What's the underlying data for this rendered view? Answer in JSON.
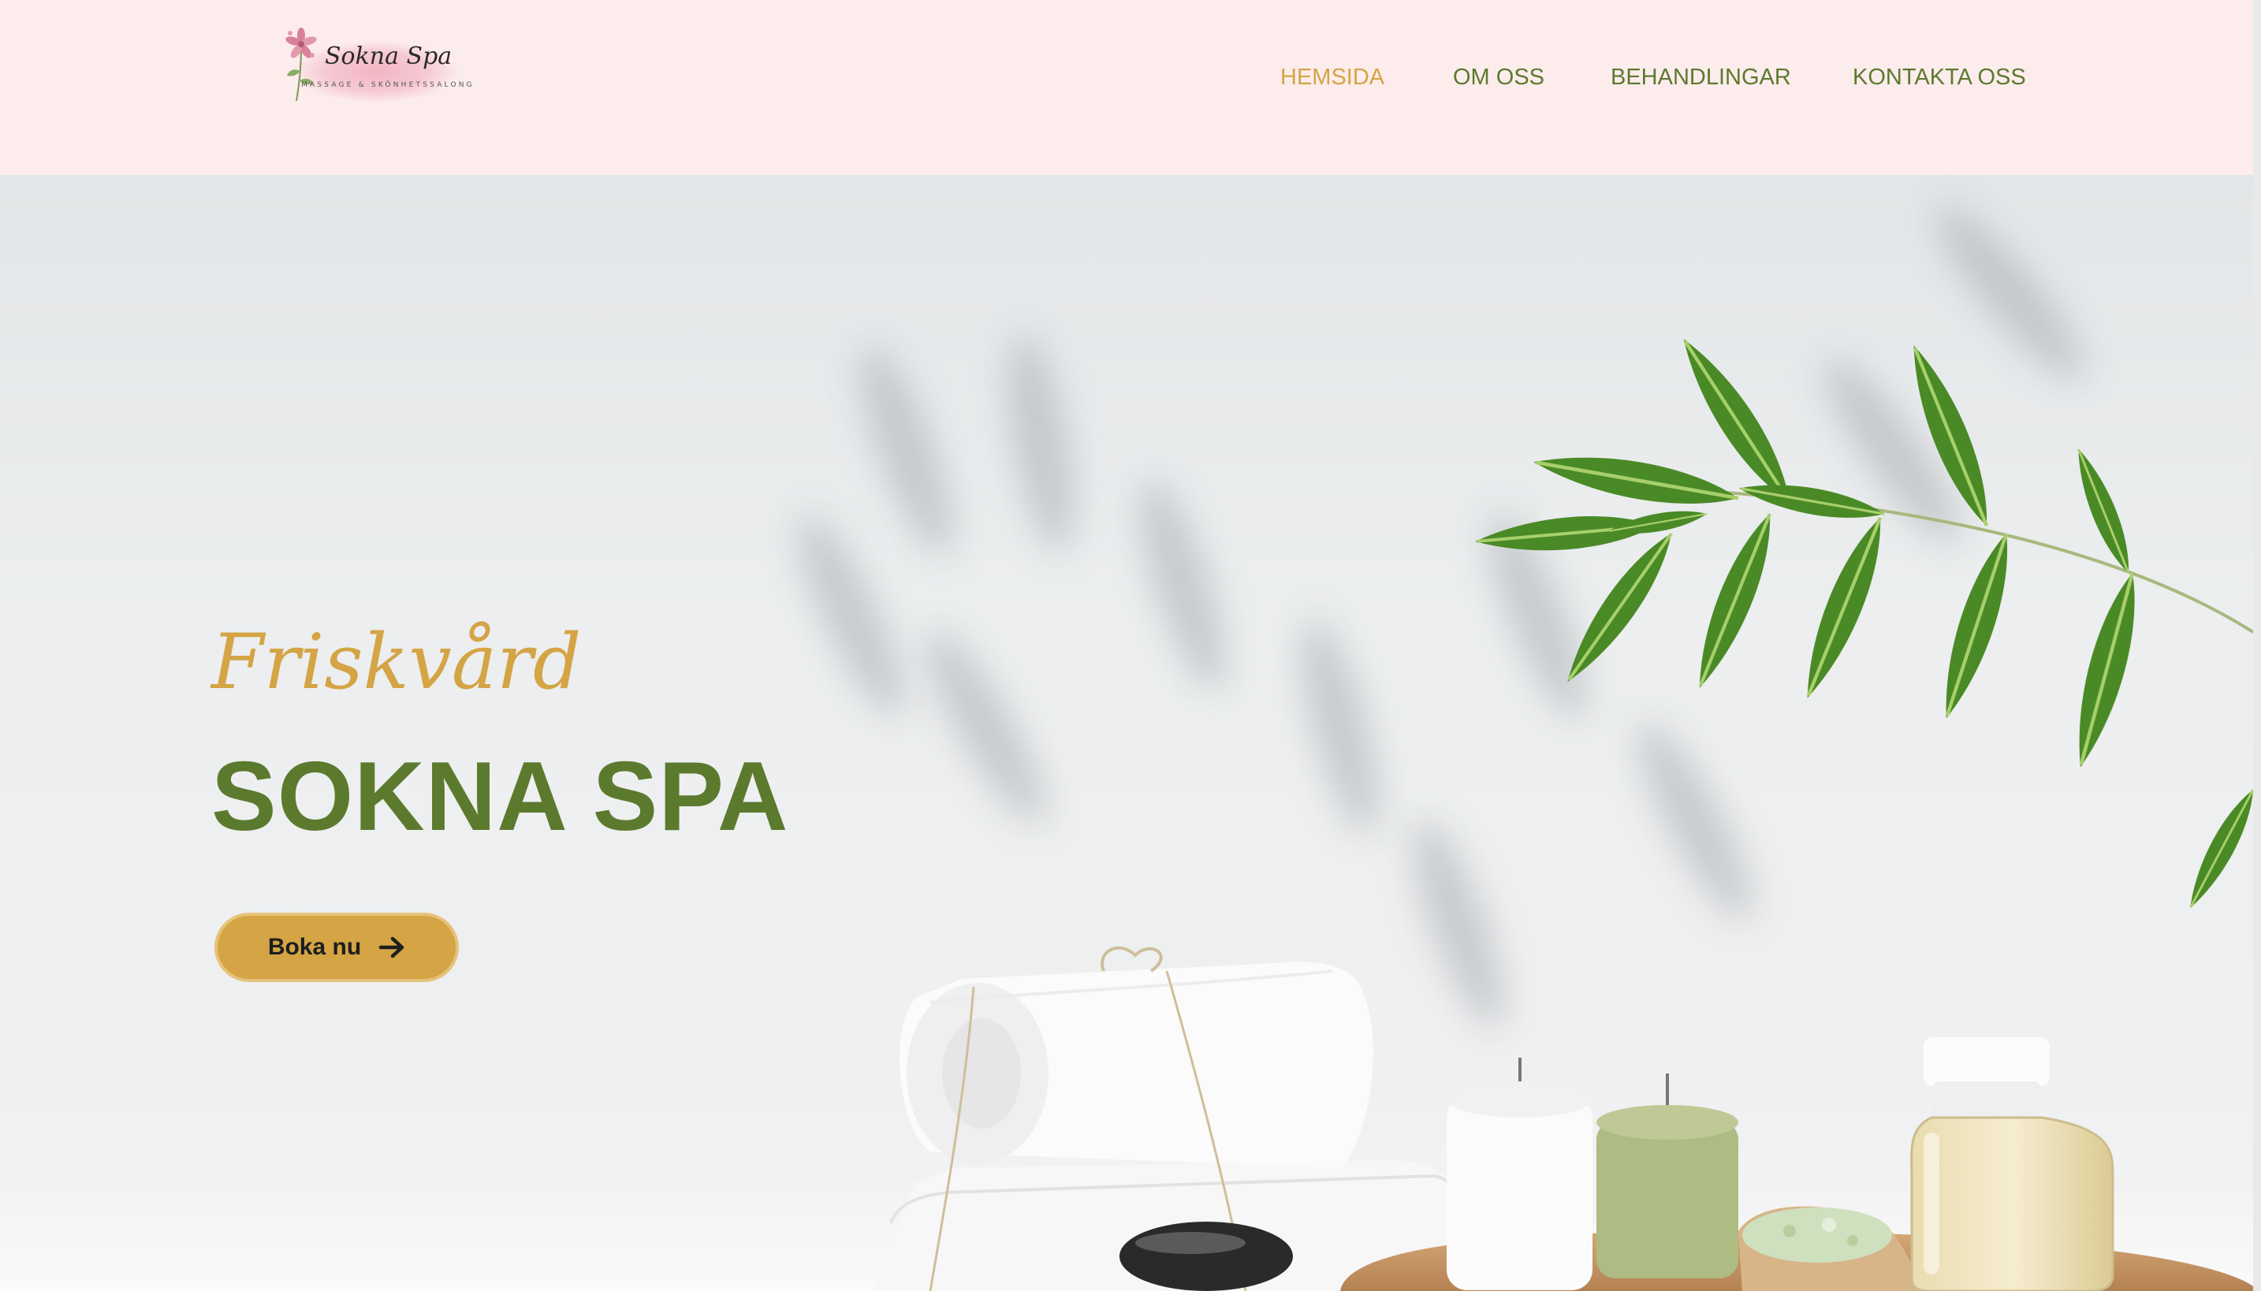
{
  "logo": {
    "title": "Sokna Spa",
    "subtitle": "MASSAGE & SKÖNHETSSALONG",
    "icon": "flower-icon"
  },
  "nav": {
    "items": [
      {
        "label": "HEMSIDA",
        "active": true
      },
      {
        "label": "OM OSS",
        "active": false
      },
      {
        "label": "BEHANDLINGAR",
        "active": false
      },
      {
        "label": "KONTAKTA OSS",
        "active": false
      }
    ]
  },
  "hero": {
    "tagline": "Friskvård",
    "title": "SOKNA SPA",
    "cta_label": "Boka nu",
    "cta_icon": "arrow-right-icon"
  },
  "colors": {
    "header_bg": "#fdecec",
    "accent_gold": "#d4a445",
    "brand_green": "#5c7a2e",
    "nav_active": "#d4a445"
  }
}
